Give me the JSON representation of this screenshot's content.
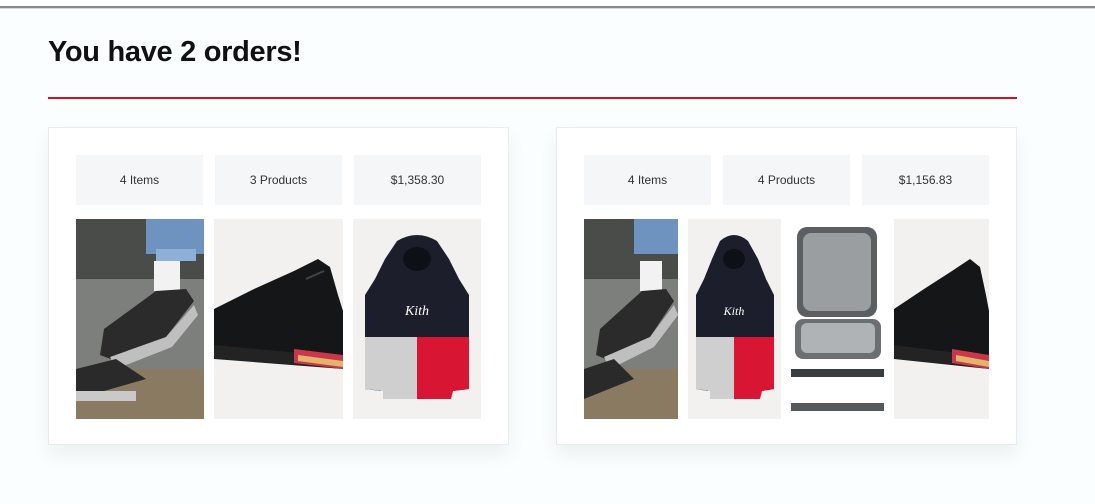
{
  "page": {
    "title": "You have 2 orders!"
  },
  "colors": {
    "accent": "#d7101c",
    "background": "#fbfefe",
    "summary_bg": "#f4f6f7"
  },
  "orders": [
    {
      "items": "4 Items",
      "products": "3 Products",
      "total": "$1,358.30",
      "images": [
        "sneaker-street-photo",
        "black-sneaker",
        "kith-hoodie"
      ]
    },
    {
      "items": "4 Items",
      "products": "4 Products",
      "total": "$1,156.83",
      "images": [
        "sneaker-street-photo",
        "kith-hoodie",
        "mesh-chair",
        "black-sneaker"
      ]
    }
  ]
}
